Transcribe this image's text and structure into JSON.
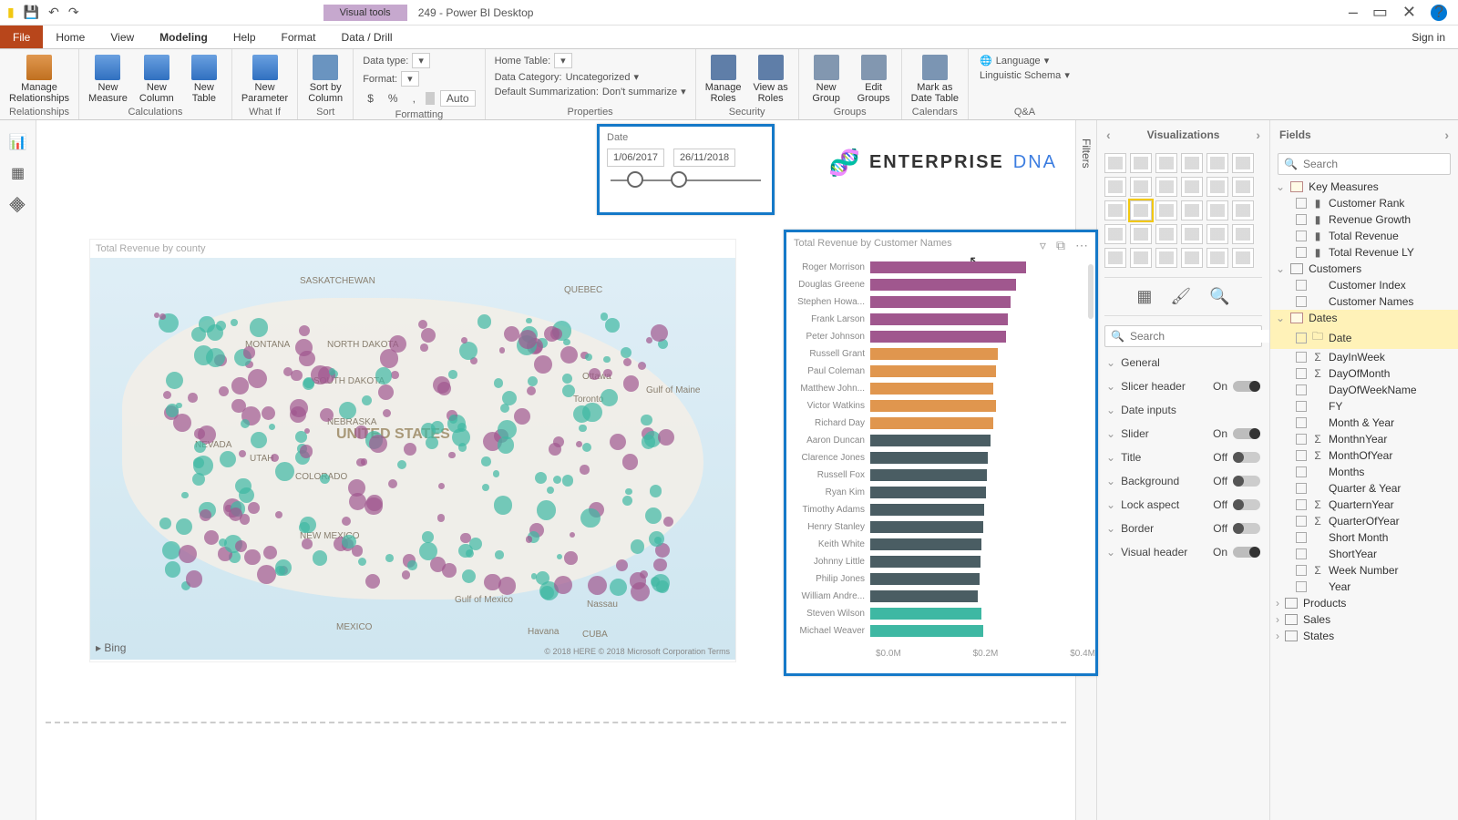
{
  "app": {
    "title": "249 - Power BI Desktop",
    "contextual": "Visual tools"
  },
  "qat": {
    "save": "💾",
    "undo": "↶",
    "redo": "↷"
  },
  "window": {
    "signin": "Sign in",
    "min": "–",
    "max": "▭",
    "close": "✕",
    "help": "?"
  },
  "tabs": [
    "File",
    "Home",
    "View",
    "Modeling",
    "Help",
    "Format",
    "Data / Drill"
  ],
  "ribbon": {
    "relationships": {
      "label": "Relationships",
      "manage": "Manage\nRelationships"
    },
    "calculations": {
      "label": "Calculations",
      "measure": "New\nMeasure",
      "column": "New\nColumn",
      "table": "New\nTable"
    },
    "whatif": {
      "label": "What If",
      "param": "New\nParameter"
    },
    "sort": {
      "label": "Sort",
      "col": "Sort by\nColumn"
    },
    "formatting": {
      "label": "Formatting",
      "datatype": "Data type:",
      "format": "Format:",
      "currency": "$",
      "percent": "%",
      "comma": ",",
      "decInc": ".0",
      "auto": "Auto"
    },
    "properties": {
      "label": "Properties",
      "home": "Home Table:",
      "category_lbl": "Data Category:",
      "category_val": "Uncategorized",
      "summar_lbl": "Default Summarization:",
      "summar_val": "Don't summarize"
    },
    "security": {
      "label": "Security",
      "manage": "Manage\nRoles",
      "view": "View as\nRoles"
    },
    "groups": {
      "label": "Groups",
      "new": "New\nGroup",
      "edit": "Edit\nGroups"
    },
    "calendars": {
      "label": "Calendars",
      "mark": "Mark as\nDate Table"
    },
    "qa": {
      "label": "Q&A",
      "lang": "Language",
      "ling": "Linguistic Schema"
    }
  },
  "rail": {
    "report": "📊",
    "data": "▦",
    "model": "卐"
  },
  "panes": {
    "filters": "Filters",
    "viz": {
      "title": "Visualizations",
      "search": "Search",
      "fmt": {
        "general": "General",
        "slicerHeader": "Slicer header",
        "dateInputs": "Date inputs",
        "slider": "Slider",
        "title": "Title",
        "background": "Background",
        "lock": "Lock aspect",
        "border": "Border",
        "visualHeader": "Visual header",
        "on": "On",
        "off": "Off"
      }
    },
    "fields": {
      "title": "Fields",
      "search": "Search",
      "tables": {
        "keyMeasures": {
          "name": "Key Measures",
          "items": [
            "Customer Rank",
            "Revenue Growth",
            "Total Revenue",
            "Total Revenue LY"
          ]
        },
        "customers": {
          "name": "Customers",
          "items": [
            "Customer Index",
            "Customer Names"
          ]
        },
        "dates": {
          "name": "Dates",
          "items": [
            {
              "n": "Date",
              "sel": true,
              "ico": "🗀"
            },
            {
              "n": "DayInWeek",
              "ico": "Σ"
            },
            {
              "n": "DayOfMonth",
              "ico": "Σ"
            },
            {
              "n": "DayOfWeekName"
            },
            {
              "n": "FY"
            },
            {
              "n": "Month & Year"
            },
            {
              "n": "MonthnYear",
              "ico": "Σ"
            },
            {
              "n": "MonthOfYear",
              "ico": "Σ"
            },
            {
              "n": "Months"
            },
            {
              "n": "Quarter & Year"
            },
            {
              "n": "QuarternYear",
              "ico": "Σ"
            },
            {
              "n": "QuarterOfYear",
              "ico": "Σ"
            },
            {
              "n": "Short Month"
            },
            {
              "n": "ShortYear"
            },
            {
              "n": "Week Number",
              "ico": "Σ"
            },
            {
              "n": "Year"
            }
          ]
        },
        "products": "Products",
        "sales": "Sales",
        "states": "States"
      }
    }
  },
  "slicer": {
    "field": "Date",
    "from": "1/06/2017",
    "to": "26/11/2018"
  },
  "logo": {
    "t1": "ENTERPRISE",
    "t2": "DNA"
  },
  "map": {
    "title": "Total Revenue by county",
    "center": "UNITED STATES",
    "labels": [
      "SASKATCHEWAN",
      "QUEBEC",
      "MONTANA",
      "NORTH DAKOTA",
      "Ottawa",
      "Toronto",
      "SOUTH DAKOTA",
      "NEBRASKA",
      "NEVADA",
      "UTAH",
      "COLORADO",
      "NEW MEXICO",
      "MEXICO",
      "Gulf of Maine",
      "Gulf of Mexico",
      "Havana",
      "CUBA",
      "Nassau"
    ],
    "bing": "▸ Bing",
    "copy": "© 2018 HERE © 2018 Microsoft Corporation Terms"
  },
  "chart_data": {
    "type": "bar",
    "title": "Total Revenue by Customer Names",
    "xlabel": "",
    "ylabel": "",
    "xlim": [
      0,
      400000
    ],
    "xticks": [
      "$0.0M",
      "$0.2M",
      "$0.4M"
    ],
    "categories": [
      "Roger Morrison",
      "Douglas Greene",
      "Stephen Howa...",
      "Frank Larson",
      "Peter Johnson",
      "Russell Grant",
      "Paul Coleman",
      "Matthew John...",
      "Victor Watkins",
      "Richard Day",
      "Aaron Duncan",
      "Clarence Jones",
      "Russell Fox",
      "Ryan Kim",
      "Timothy Adams",
      "Henry Stanley",
      "Keith White",
      "Johnny Little",
      "Philip Jones",
      "William Andre...",
      "Steven Wilson",
      "Michael Weaver"
    ],
    "values": [
      310000,
      290000,
      280000,
      275000,
      270000,
      255000,
      250000,
      245000,
      250000,
      245000,
      240000,
      235000,
      232000,
      230000,
      228000,
      225000,
      222000,
      220000,
      218000,
      215000,
      222000,
      225000
    ],
    "colors": [
      "#a0578e",
      "#a0578e",
      "#a0578e",
      "#a0578e",
      "#a0578e",
      "#e0964e",
      "#e0964e",
      "#e0964e",
      "#e0964e",
      "#e0964e",
      "#4a5d63",
      "#4a5d63",
      "#4a5d63",
      "#4a5d63",
      "#4a5d63",
      "#4a5d63",
      "#4a5d63",
      "#4a5d63",
      "#4a5d63",
      "#4a5d63",
      "#3eb8a3",
      "#3eb8a3"
    ]
  }
}
